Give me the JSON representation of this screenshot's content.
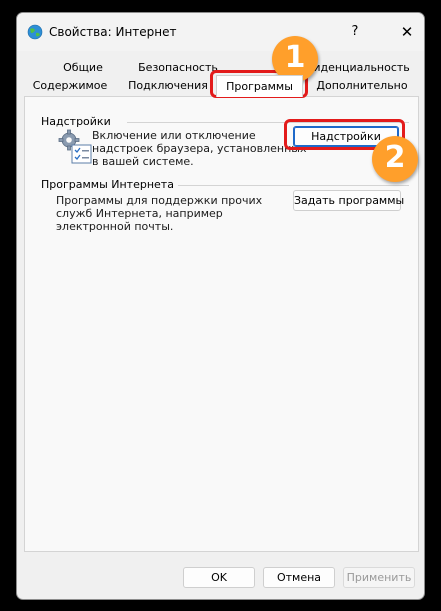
{
  "window": {
    "title": "Свойства: Интернет",
    "help_label": "?",
    "close_label": "✕"
  },
  "tabs": {
    "row1": [
      "Общие",
      "Безопасность",
      "Конфиденциальность"
    ],
    "row2": [
      "Содержимое",
      "Подключения",
      "Программы",
      "Дополнительно"
    ],
    "active": "Программы"
  },
  "addons_group": {
    "label": "Надстройки",
    "description_lines": [
      "Включение или отключение",
      "надстроек браузера, установленных",
      "в вашей системе."
    ],
    "button_label": "Надстройки"
  },
  "internet_programs_group": {
    "label": "Программы Интернета",
    "description_lines": [
      "Программы для поддержки прочих",
      "служб Интернета, например",
      "электронной почты."
    ],
    "button_label": "Задать программы"
  },
  "footer": {
    "ok_label": "OK",
    "cancel_label": "Отмена",
    "apply_label": "Применить"
  },
  "annotations": {
    "badge1": "1",
    "badge2": "2",
    "color": "#e31b1b",
    "badge_color": "#ff9f2b"
  },
  "colors": {
    "accent": "#1e69c9",
    "window_bg": "#f0f0f0",
    "panel_bg": "#f9f9f9"
  }
}
